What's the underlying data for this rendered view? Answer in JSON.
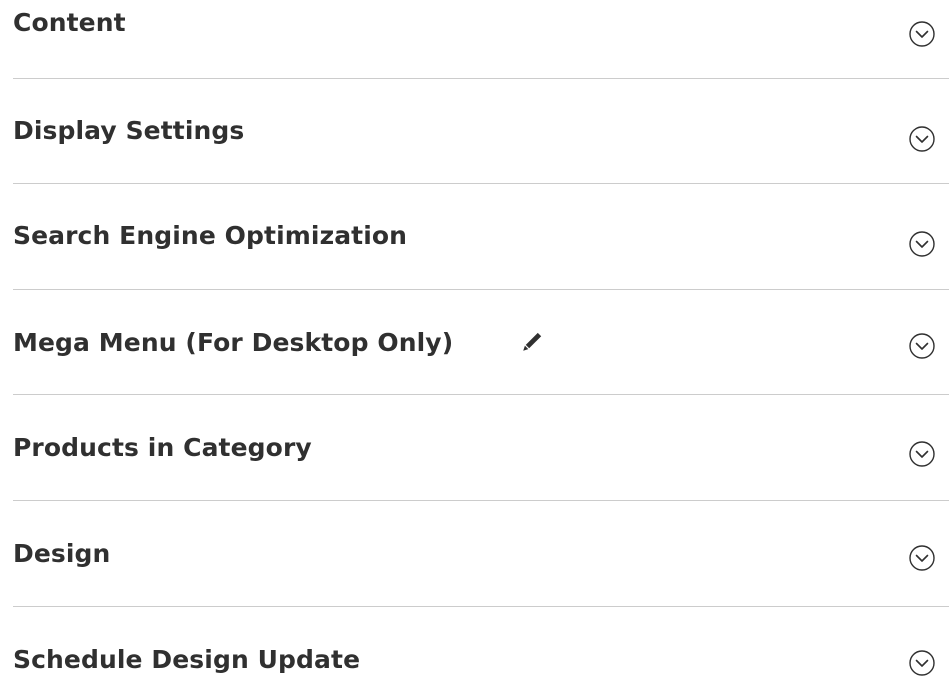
{
  "sections": [
    {
      "title": "Content",
      "expanded": false
    },
    {
      "title": "Display Settings",
      "expanded": false
    },
    {
      "title": "Search Engine Optimization",
      "expanded": false
    },
    {
      "title": "Mega Menu (For Desktop Only)",
      "expanded": false,
      "edit_icon": "pencil-icon"
    },
    {
      "title": "Products in Category",
      "expanded": false
    },
    {
      "title": "Design",
      "expanded": false
    },
    {
      "title": "Schedule Design Update",
      "expanded": false
    }
  ],
  "icons": {
    "toggle": "chevron-down-circle-icon",
    "edit": "pencil-icon"
  },
  "colors": {
    "title": "#303030",
    "divider": "#cccccc",
    "icon": "#303030"
  }
}
